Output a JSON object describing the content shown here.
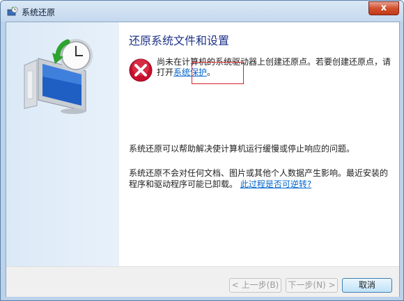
{
  "window": {
    "title": "系统还原",
    "close_label": "x"
  },
  "content": {
    "heading": "还原系统文件和设置",
    "message_pre": "尚未在计算机的系统驱动器上创建还原点。若要创建还原点，请打开",
    "message_link": "系统保护",
    "message_post": "。",
    "para1": "系统还原可以帮助解决使计算机运行缓慢或停止响应的问题。",
    "para2_text": "系统还原不会对任何文档、图片或其他个人数据产生影响。最近安装的程序和驱动程序可能已卸载。",
    "para2_link": "此过程是否可逆转?"
  },
  "footer": {
    "back_label": "< 上一步(B)",
    "next_label": "下一步(N) >",
    "cancel_label": "取消"
  },
  "colors": {
    "heading": "#1e3287",
    "link": "#0066cc",
    "error_red": "#c8102e",
    "highlight_box": "#d8202b"
  },
  "icons": {
    "title": "system-restore-icon",
    "hero": "system-restore-clock-monitor-icon",
    "error": "error-x-icon"
  }
}
